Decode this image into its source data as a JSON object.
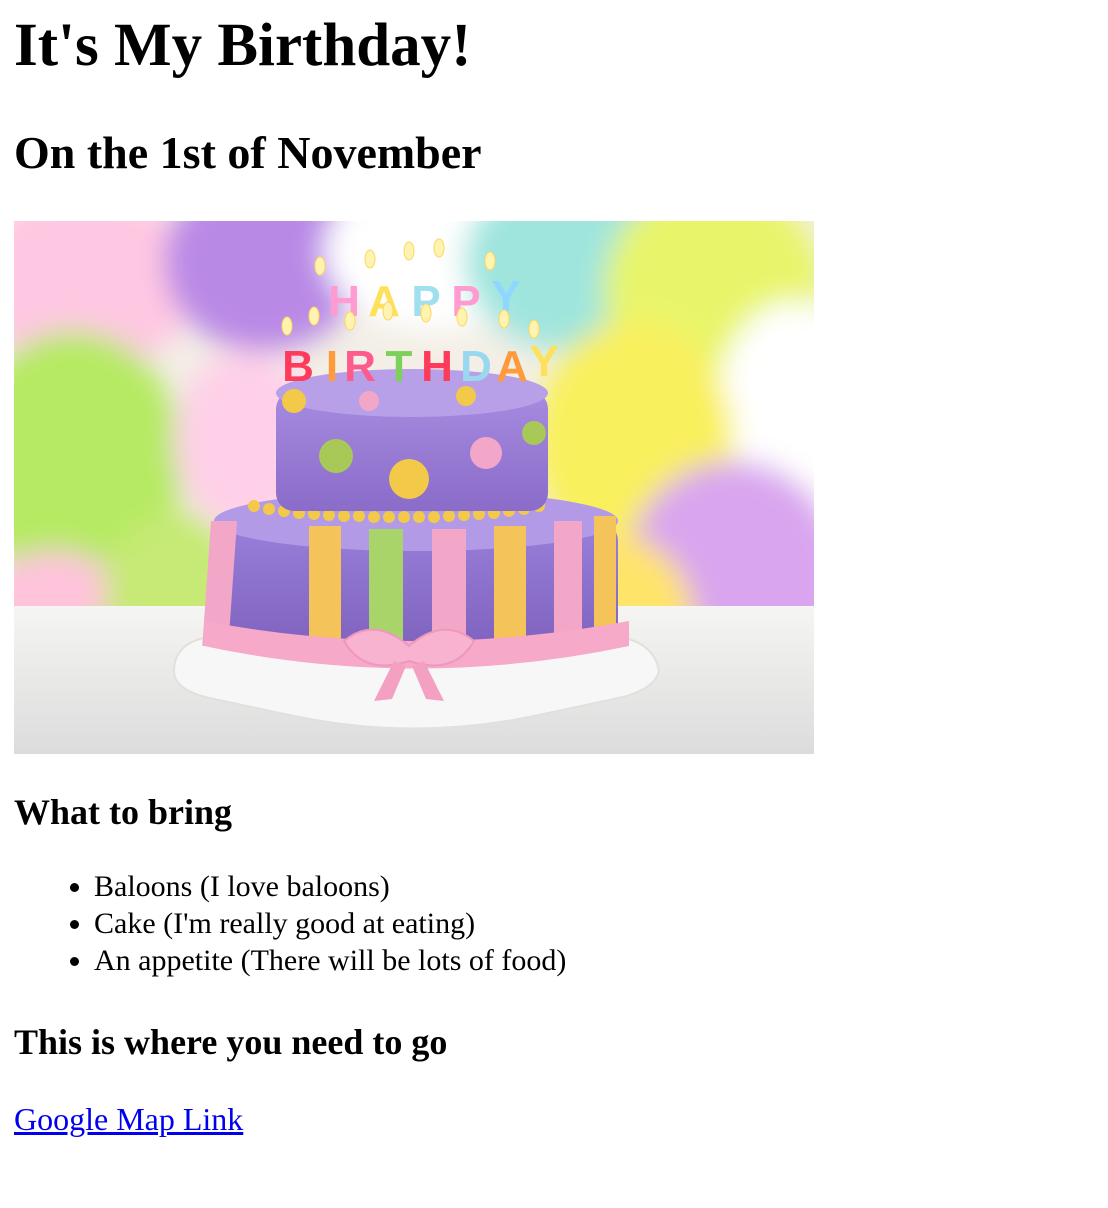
{
  "header": {
    "title": "It's My Birthday!",
    "subtitle": "On the 1st of November"
  },
  "image": {
    "alt": "Birthday cake",
    "candle_letters": [
      "HAPPY",
      "BIRTHDAY"
    ],
    "colors": {
      "background_balloons": [
        "#c8f27a",
        "#b47fe0",
        "#f7d24b",
        "#ffb0d8",
        "#9fe2f0",
        "#ffe84f"
      ],
      "cake_top": "#9b7fd6",
      "cake_bottom": "#8e6fcf",
      "ribbon": "#f6a9c8",
      "stripe_yellow": "#f4c35a",
      "stripe_green": "#a8d46a",
      "stripe_pink": "#f3a7c8",
      "plate": "#f4f4f4"
    }
  },
  "bring": {
    "heading": "What to bring",
    "items": [
      "Baloons (I love baloons)",
      "Cake (I'm really good at eating)",
      "An appetite (There will be lots of food)"
    ]
  },
  "location": {
    "heading": "This is where you need to go",
    "link_label": "Google Map Link"
  }
}
